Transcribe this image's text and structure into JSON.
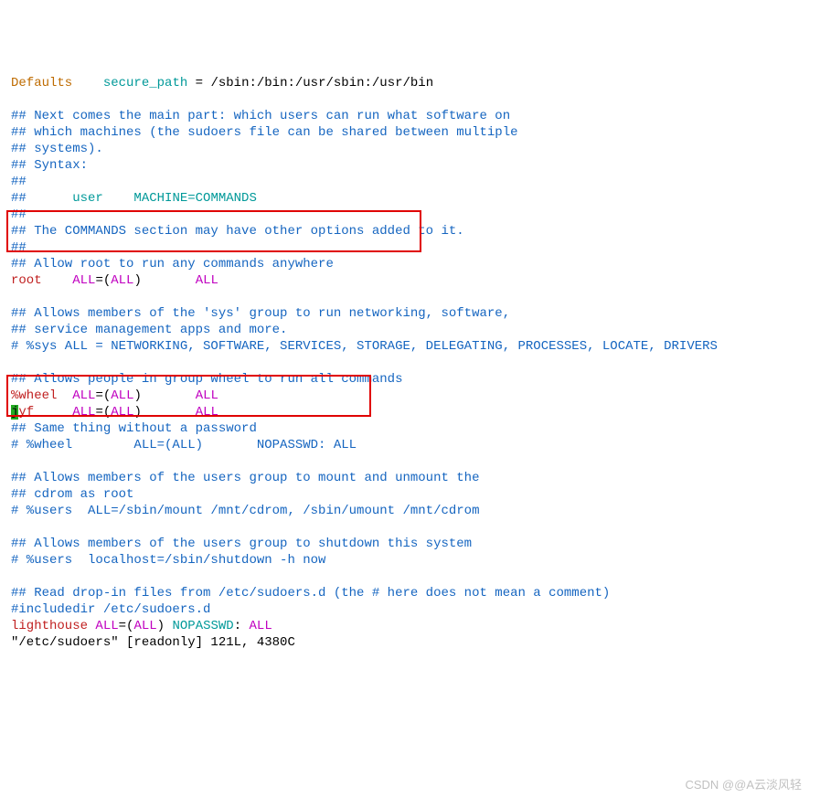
{
  "l1": {
    "defaults": "Defaults",
    "key": "secure_path",
    "eq": " = ",
    "val": "/sbin:/bin:/usr/sbin:/usr/bin"
  },
  "c1": "## Next comes the main part: which users can run what software on",
  "c2": "## which machines (the sudoers file can be shared between multiple",
  "c3": "## systems).",
  "c4": "## Syntax:",
  "c5": "##",
  "c6a": "##",
  "c6b": "      user    MACHINE=COMMANDS",
  "c7": "##",
  "c8": "## The COMMANDS section may have other options added to it.",
  "c9": "##",
  "c10": "## Allow root to run any commands anywhere",
  "root_line": {
    "user": "root",
    "pad1": "    ",
    "all1": "ALL",
    "eq": "=(",
    "all2": "ALL",
    "close": ")",
    "pad2": "       ",
    "all3": "ALL"
  },
  "c11": "## Allows members of the 'sys' group to run networking, software,",
  "c12": "## service management apps and more.",
  "c13": "# %sys ALL = NETWORKING, SOFTWARE, SERVICES, STORAGE, DELEGATING, PROCESSES, LOCATE, DRIVERS",
  "c14": "## Allows people in group wheel to run all commands",
  "wheel_line": {
    "user": "%wheel",
    "pad1": "  ",
    "all1": "ALL",
    "eq": "=(",
    "all2": "ALL",
    "close": ")",
    "pad2": "       ",
    "all3": "ALL"
  },
  "jyf_line": {
    "cursor": "j",
    "rest": "yf",
    "pad1": "     ",
    "all1": "ALL",
    "eq": "=(",
    "all2": "ALL",
    "close": ")",
    "pad2": "       ",
    "all3": "ALL"
  },
  "c15": "## Same thing without a password",
  "c16": "# %wheel        ALL=(ALL)       NOPASSWD: ALL",
  "c17": "## Allows members of the users group to mount and unmount the",
  "c18": "## cdrom as root",
  "c19": "# %users  ALL=/sbin/mount /mnt/cdrom, /sbin/umount /mnt/cdrom",
  "c20": "## Allows members of the users group to shutdown this system",
  "c21": "# %users  localhost=/sbin/shutdown -h now",
  "c22": "## Read drop-in files from /etc/sudoers.d (the # here does not mean a comment)",
  "c23": "#includedir /etc/sudoers.d",
  "lh_line": {
    "user": "lighthouse",
    "sp": " ",
    "all1": "ALL",
    "eq": "=(",
    "all2": "ALL",
    "close": ") ",
    "np": "NOPASSWD",
    "colon": ": ",
    "all3": "ALL"
  },
  "status": "\"/etc/sudoers\" [readonly] 121L, 4380C",
  "watermark": "CSDN @@A云淡风轻"
}
